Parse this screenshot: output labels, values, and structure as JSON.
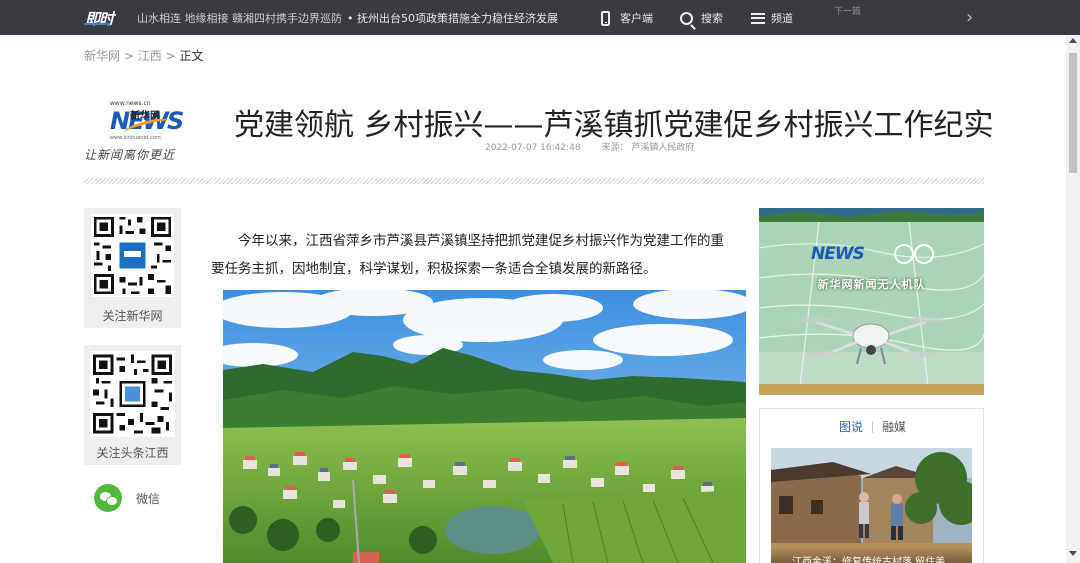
{
  "topbar": {
    "logo": "即时",
    "news": [
      "山水相连 地缘相接 赣湘四村携手边界巡防",
      "• 抚州出台50项政策措施全力稳住经济发展"
    ],
    "tools": {
      "client": "客户端",
      "search": "搜索",
      "channels": "频道"
    },
    "next_label": "下一篇",
    "next_arrow": "›"
  },
  "breadcrumb": {
    "home": "新华网",
    "separator": ">",
    "section": "江西",
    "current": "正文"
  },
  "brand": {
    "url_top": "www.news.cn",
    "mark_letter": "NEWS",
    "mark_cn": "新华网",
    "url_bottom": "www.xinhuanet.com",
    "slogan": "让新闻离你更近"
  },
  "article": {
    "title": "党建领航 乡村振兴——芦溪镇抓党建促乡村振兴工作纪实",
    "datetime": "2022-07-07 16:42:48",
    "source_label": "来源：",
    "source": "芦溪镇人民政府",
    "lead": "今年以来，江西省萍乡市芦溪县芦溪镇坚持把抓党建促乡村振兴作为党建工作的重要任务主抓，因地制宜，科学谋划，积极探索一条适合全镇发展的新路径。"
  },
  "share": {
    "follow_xinhua": "关注新华网",
    "follow_toutiao": "关注头条江西",
    "wechat": "微信"
  },
  "right": {
    "ad_logo": "NEWS",
    "ad_caption": "新华网新闻无人机队",
    "tabs": [
      "图说",
      "融媒"
    ],
    "thumb_caption": "江西金溪：修复传统古村落 留住美"
  },
  "colors": {
    "topbar_bg": "#3a3a40",
    "accent_blue": "#1f68c6",
    "wechat_green": "#52b83b"
  }
}
